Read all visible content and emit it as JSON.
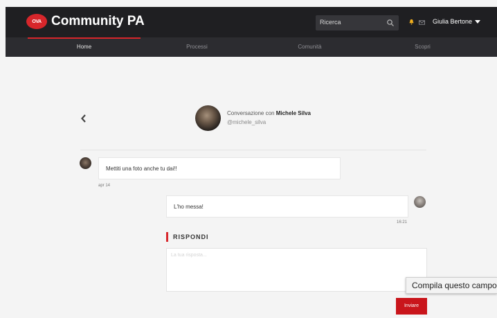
{
  "header": {
    "logo_mark": "OVA",
    "logo_text": "Community PA",
    "search_label": "Ricerca",
    "user_name": "Giulia Bertone"
  },
  "nav": {
    "items": [
      {
        "label": "Home",
        "active": true
      },
      {
        "label": "Processi",
        "active": false
      },
      {
        "label": "Comunità",
        "active": false
      },
      {
        "label": "Scopri",
        "active": false
      }
    ]
  },
  "conversation": {
    "prefix": "Conversazione con ",
    "name": "Michele Silva",
    "handle": "@michele_silva"
  },
  "messages": [
    {
      "text": "Mettiti una foto anche tu dai!!",
      "time": "apr 14",
      "side": "left"
    },
    {
      "text": "L'ho messa!",
      "time": "16:21",
      "side": "right"
    }
  ],
  "reply": {
    "label": "RISPONDI",
    "placeholder": "La tua risposta...",
    "value": "",
    "send_label": "Inviare"
  },
  "tooltip": {
    "text": "Compila questo campo."
  },
  "colors": {
    "accent": "#d7262b",
    "header_bg": "#1f1f22",
    "nav_bg": "#2c2c30"
  }
}
